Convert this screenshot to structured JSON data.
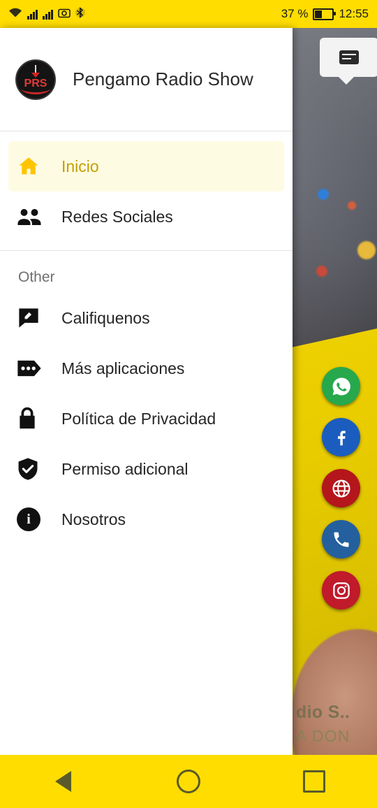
{
  "status_bar": {
    "time": "12:55",
    "battery_percent": "37 %",
    "icons": [
      "wifi-icon",
      "signal-bars-icon",
      "signal-bars-2-icon",
      "camera-icon",
      "bluetooth-icon",
      "battery-icon"
    ],
    "background_color": "#FFDD00"
  },
  "drawer": {
    "app_title": "Pengamo Radio Show",
    "logo_text": "PRS",
    "primary_items": [
      {
        "label": "Inicio",
        "icon": "home-icon",
        "selected": true
      },
      {
        "label": "Redes Sociales",
        "icon": "people-icon",
        "selected": false
      }
    ],
    "section_label": "Other",
    "other_items": [
      {
        "label": "Califiquenos",
        "icon": "rate-review-icon"
      },
      {
        "label": "Más aplicaciones",
        "icon": "more-apps-icon"
      },
      {
        "label": "Política de Privacidad",
        "icon": "lock-icon"
      },
      {
        "label": "Permiso adicional",
        "icon": "shield-check-icon"
      },
      {
        "label": "Nosotros",
        "icon": "info-icon"
      }
    ],
    "selected_accent": "#c2a000",
    "selected_background": "#fefbe3"
  },
  "background_app": {
    "title_fragment": "dio S..",
    "subtitle_fragment": "A DON",
    "chat_icon": "chat-bubble-icon",
    "social_buttons": [
      {
        "name": "whatsapp-icon",
        "color": "#27a84d"
      },
      {
        "name": "facebook-icon",
        "color": "#1b5dbe"
      },
      {
        "name": "website-icon",
        "color": "#b4161c"
      },
      {
        "name": "phone-icon",
        "color": "#24609e"
      },
      {
        "name": "instagram-icon",
        "color": "#c01a2b"
      }
    ]
  },
  "nav_bar": {
    "background_color": "#FFDD00",
    "buttons": [
      {
        "name": "back-button",
        "icon": "triangle-back-icon"
      },
      {
        "name": "home-button",
        "icon": "circle-home-icon"
      },
      {
        "name": "recents-button",
        "icon": "square-recents-icon"
      }
    ]
  }
}
